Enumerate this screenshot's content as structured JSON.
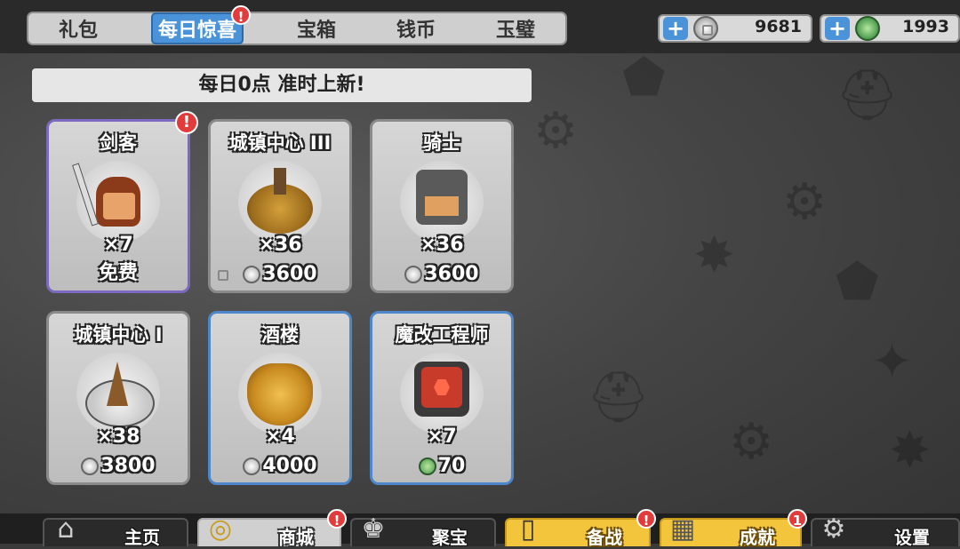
{
  "tabs": [
    {
      "label": "礼包",
      "active": false,
      "alert": false
    },
    {
      "label": "每日惊喜",
      "active": true,
      "alert": true
    },
    {
      "label": "宝箱",
      "active": false,
      "alert": false
    },
    {
      "label": "钱币",
      "active": false,
      "alert": false
    },
    {
      "label": "玉璧",
      "active": false,
      "alert": false
    }
  ],
  "currency": {
    "silver": {
      "value": "9681",
      "icon": "silver-coin-icon"
    },
    "jade": {
      "value": "1993",
      "icon": "jade-icon"
    }
  },
  "alert_symbol": "!",
  "banner": "每日0点 准时上新!",
  "cards": [
    {
      "title": "剑客",
      "qty": "×7",
      "price": "免费",
      "currency": "",
      "alert": true,
      "border": "purple"
    },
    {
      "title": "城镇中心 III",
      "qty": "×36",
      "price": "3600",
      "currency": "silver",
      "alert": false,
      "border": "gray"
    },
    {
      "title": "骑士",
      "qty": "×36",
      "price": "3600",
      "currency": "silver",
      "alert": false,
      "border": "gray"
    },
    {
      "title": "城镇中心 I",
      "qty": "×38",
      "price": "3800",
      "currency": "silver",
      "alert": false,
      "border": "gray"
    },
    {
      "title": "酒楼",
      "qty": "×4",
      "price": "4000",
      "currency": "silver",
      "alert": false,
      "border": "blue"
    },
    {
      "title": "魔改工程师",
      "qty": "×7",
      "price": "70",
      "currency": "jade",
      "alert": false,
      "border": "blue"
    }
  ],
  "nav": [
    {
      "label": "主页",
      "icon": "home-icon",
      "alert": ""
    },
    {
      "label": "商城",
      "icon": "shop-icon",
      "alert": "!"
    },
    {
      "label": "聚宝",
      "icon": "treasure-icon",
      "alert": ""
    },
    {
      "label": "备战",
      "icon": "cards-icon",
      "alert": "!"
    },
    {
      "label": "成就",
      "icon": "achievement-icon",
      "alert": "1"
    },
    {
      "label": "设置",
      "icon": "settings-icon",
      "alert": ""
    }
  ],
  "colors": {
    "active_tab": "#4a93d8",
    "alert": "#e13b3b",
    "shop_tab": "#d0d0d0",
    "prepare_tab": "#f2c53d",
    "achievement_tab": "#f2c53d"
  }
}
